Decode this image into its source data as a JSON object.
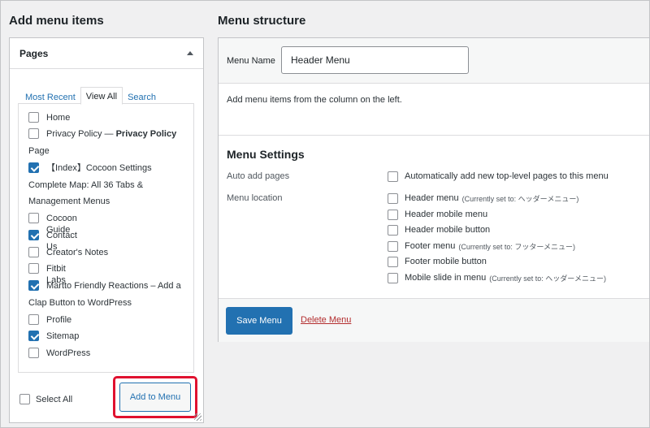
{
  "left": {
    "title": "Add menu items",
    "box_title": "Pages",
    "tabs": [
      "Most Recent",
      "View All",
      "Search"
    ],
    "items": [
      {
        "label": "Home",
        "checked": false
      },
      {
        "label": "Privacy Policy — ",
        "bold": "Privacy Policy",
        "cont": "Page",
        "checked": false
      },
      {
        "label": "【Index】Cocoon Settings",
        "cont": "Complete Map: All 36 Tabs &",
        "cont2": "Management Menus",
        "checked": true
      },
      {
        "label": "Cocoon Guide",
        "checked": false
      },
      {
        "label": "Contact Us",
        "checked": true
      },
      {
        "label": "Creator's Notes",
        "checked": false
      },
      {
        "label": "Fitbit Labs",
        "checked": false
      },
      {
        "label": "Martto Friendly Reactions – Add a",
        "cont": "Clap Button to WordPress",
        "checked": true
      },
      {
        "label": "Profile",
        "checked": false
      },
      {
        "label": "Sitemap",
        "checked": true
      },
      {
        "label": "WordPress",
        "checked": false
      }
    ],
    "select_all": "Select All",
    "add_button": "Add to Menu"
  },
  "right": {
    "title": "Menu structure",
    "name_label": "Menu Name",
    "name_value": "Header Menu",
    "instruction": "Add menu items from the column on the left.",
    "settings_title": "Menu Settings",
    "auto_add_label": "Auto add pages",
    "auto_add_option": "Automatically add new top-level pages to this menu",
    "location_label": "Menu location",
    "locations": [
      {
        "label": "Header menu",
        "note": "(Currently set to: ヘッダーメニュー)"
      },
      {
        "label": "Header mobile menu",
        "note": ""
      },
      {
        "label": "Header mobile button",
        "note": ""
      },
      {
        "label": "Footer menu",
        "note": "(Currently set to: フッターメニュー)"
      },
      {
        "label": "Footer mobile button",
        "note": ""
      },
      {
        "label": "Mobile slide in menu",
        "note": "(Currently set to: ヘッダーメニュー)"
      }
    ],
    "save_button": "Save Menu",
    "delete_link": "Delete Menu"
  },
  "colors": {
    "accent": "#2271b1",
    "highlight": "#e0112f",
    "delete": "#b32d2e"
  }
}
